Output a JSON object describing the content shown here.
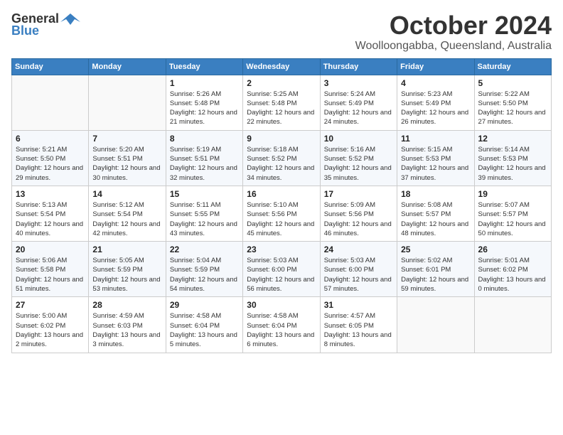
{
  "logo": {
    "general": "General",
    "blue": "Blue"
  },
  "title": {
    "month": "October 2024",
    "location": "Woolloongabba, Queensland, Australia"
  },
  "headers": [
    "Sunday",
    "Monday",
    "Tuesday",
    "Wednesday",
    "Thursday",
    "Friday",
    "Saturday"
  ],
  "weeks": [
    [
      {
        "day": "",
        "sunrise": "",
        "sunset": "",
        "daylight": ""
      },
      {
        "day": "",
        "sunrise": "",
        "sunset": "",
        "daylight": ""
      },
      {
        "day": "1",
        "sunrise": "Sunrise: 5:26 AM",
        "sunset": "Sunset: 5:48 PM",
        "daylight": "Daylight: 12 hours and 21 minutes."
      },
      {
        "day": "2",
        "sunrise": "Sunrise: 5:25 AM",
        "sunset": "Sunset: 5:48 PM",
        "daylight": "Daylight: 12 hours and 22 minutes."
      },
      {
        "day": "3",
        "sunrise": "Sunrise: 5:24 AM",
        "sunset": "Sunset: 5:49 PM",
        "daylight": "Daylight: 12 hours and 24 minutes."
      },
      {
        "day": "4",
        "sunrise": "Sunrise: 5:23 AM",
        "sunset": "Sunset: 5:49 PM",
        "daylight": "Daylight: 12 hours and 26 minutes."
      },
      {
        "day": "5",
        "sunrise": "Sunrise: 5:22 AM",
        "sunset": "Sunset: 5:50 PM",
        "daylight": "Daylight: 12 hours and 27 minutes."
      }
    ],
    [
      {
        "day": "6",
        "sunrise": "Sunrise: 5:21 AM",
        "sunset": "Sunset: 5:50 PM",
        "daylight": "Daylight: 12 hours and 29 minutes."
      },
      {
        "day": "7",
        "sunrise": "Sunrise: 5:20 AM",
        "sunset": "Sunset: 5:51 PM",
        "daylight": "Daylight: 12 hours and 30 minutes."
      },
      {
        "day": "8",
        "sunrise": "Sunrise: 5:19 AM",
        "sunset": "Sunset: 5:51 PM",
        "daylight": "Daylight: 12 hours and 32 minutes."
      },
      {
        "day": "9",
        "sunrise": "Sunrise: 5:18 AM",
        "sunset": "Sunset: 5:52 PM",
        "daylight": "Daylight: 12 hours and 34 minutes."
      },
      {
        "day": "10",
        "sunrise": "Sunrise: 5:16 AM",
        "sunset": "Sunset: 5:52 PM",
        "daylight": "Daylight: 12 hours and 35 minutes."
      },
      {
        "day": "11",
        "sunrise": "Sunrise: 5:15 AM",
        "sunset": "Sunset: 5:53 PM",
        "daylight": "Daylight: 12 hours and 37 minutes."
      },
      {
        "day": "12",
        "sunrise": "Sunrise: 5:14 AM",
        "sunset": "Sunset: 5:53 PM",
        "daylight": "Daylight: 12 hours and 39 minutes."
      }
    ],
    [
      {
        "day": "13",
        "sunrise": "Sunrise: 5:13 AM",
        "sunset": "Sunset: 5:54 PM",
        "daylight": "Daylight: 12 hours and 40 minutes."
      },
      {
        "day": "14",
        "sunrise": "Sunrise: 5:12 AM",
        "sunset": "Sunset: 5:54 PM",
        "daylight": "Daylight: 12 hours and 42 minutes."
      },
      {
        "day": "15",
        "sunrise": "Sunrise: 5:11 AM",
        "sunset": "Sunset: 5:55 PM",
        "daylight": "Daylight: 12 hours and 43 minutes."
      },
      {
        "day": "16",
        "sunrise": "Sunrise: 5:10 AM",
        "sunset": "Sunset: 5:56 PM",
        "daylight": "Daylight: 12 hours and 45 minutes."
      },
      {
        "day": "17",
        "sunrise": "Sunrise: 5:09 AM",
        "sunset": "Sunset: 5:56 PM",
        "daylight": "Daylight: 12 hours and 46 minutes."
      },
      {
        "day": "18",
        "sunrise": "Sunrise: 5:08 AM",
        "sunset": "Sunset: 5:57 PM",
        "daylight": "Daylight: 12 hours and 48 minutes."
      },
      {
        "day": "19",
        "sunrise": "Sunrise: 5:07 AM",
        "sunset": "Sunset: 5:57 PM",
        "daylight": "Daylight: 12 hours and 50 minutes."
      }
    ],
    [
      {
        "day": "20",
        "sunrise": "Sunrise: 5:06 AM",
        "sunset": "Sunset: 5:58 PM",
        "daylight": "Daylight: 12 hours and 51 minutes."
      },
      {
        "day": "21",
        "sunrise": "Sunrise: 5:05 AM",
        "sunset": "Sunset: 5:59 PM",
        "daylight": "Daylight: 12 hours and 53 minutes."
      },
      {
        "day": "22",
        "sunrise": "Sunrise: 5:04 AM",
        "sunset": "Sunset: 5:59 PM",
        "daylight": "Daylight: 12 hours and 54 minutes."
      },
      {
        "day": "23",
        "sunrise": "Sunrise: 5:03 AM",
        "sunset": "Sunset: 6:00 PM",
        "daylight": "Daylight: 12 hours and 56 minutes."
      },
      {
        "day": "24",
        "sunrise": "Sunrise: 5:03 AM",
        "sunset": "Sunset: 6:00 PM",
        "daylight": "Daylight: 12 hours and 57 minutes."
      },
      {
        "day": "25",
        "sunrise": "Sunrise: 5:02 AM",
        "sunset": "Sunset: 6:01 PM",
        "daylight": "Daylight: 12 hours and 59 minutes."
      },
      {
        "day": "26",
        "sunrise": "Sunrise: 5:01 AM",
        "sunset": "Sunset: 6:02 PM",
        "daylight": "Daylight: 13 hours and 0 minutes."
      }
    ],
    [
      {
        "day": "27",
        "sunrise": "Sunrise: 5:00 AM",
        "sunset": "Sunset: 6:02 PM",
        "daylight": "Daylight: 13 hours and 2 minutes."
      },
      {
        "day": "28",
        "sunrise": "Sunrise: 4:59 AM",
        "sunset": "Sunset: 6:03 PM",
        "daylight": "Daylight: 13 hours and 3 minutes."
      },
      {
        "day": "29",
        "sunrise": "Sunrise: 4:58 AM",
        "sunset": "Sunset: 6:04 PM",
        "daylight": "Daylight: 13 hours and 5 minutes."
      },
      {
        "day": "30",
        "sunrise": "Sunrise: 4:58 AM",
        "sunset": "Sunset: 6:04 PM",
        "daylight": "Daylight: 13 hours and 6 minutes."
      },
      {
        "day": "31",
        "sunrise": "Sunrise: 4:57 AM",
        "sunset": "Sunset: 6:05 PM",
        "daylight": "Daylight: 13 hours and 8 minutes."
      },
      {
        "day": "",
        "sunrise": "",
        "sunset": "",
        "daylight": ""
      },
      {
        "day": "",
        "sunrise": "",
        "sunset": "",
        "daylight": ""
      }
    ]
  ]
}
